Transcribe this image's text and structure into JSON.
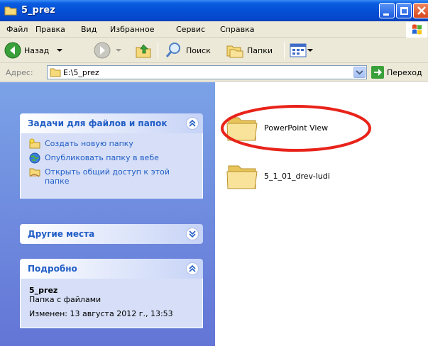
{
  "window": {
    "title": "5_prez"
  },
  "menu": {
    "items": [
      "Файл",
      "Правка",
      "Вид",
      "Избранное",
      "Сервис",
      "Справка"
    ]
  },
  "toolbar": {
    "back_label": "Назад",
    "search_label": "Поиск",
    "folders_label": "Папки"
  },
  "address": {
    "label": "Адрес:",
    "value": "E:\\5_prez",
    "go_label": "Переход"
  },
  "tasks_panel": {
    "title": "Задачи для файлов и папок",
    "items": [
      {
        "label": "Создать новую папку",
        "icon": "new-folder-icon"
      },
      {
        "label": "Опубликовать папку в вебе",
        "icon": "globe-icon"
      },
      {
        "label": "Открыть общий доступ к этой папке",
        "icon": "share-folder-icon"
      }
    ]
  },
  "other_places_panel": {
    "title": "Другие места"
  },
  "details_panel": {
    "title": "Подробно",
    "name": "5_prez",
    "type": "Папка с файлами",
    "modified": "Изменен: 13 августа 2012 г., 13:53"
  },
  "files": [
    {
      "name": "PowerPoint View",
      "highlighted": true
    },
    {
      "name": "5_1_01_drev-ludi",
      "highlighted": false
    }
  ],
  "colors": {
    "title_blue": "#0550d6",
    "panel_link": "#215dc6",
    "highlight_ring": "#e8231a",
    "folder_yellow": "#f5d97a"
  }
}
